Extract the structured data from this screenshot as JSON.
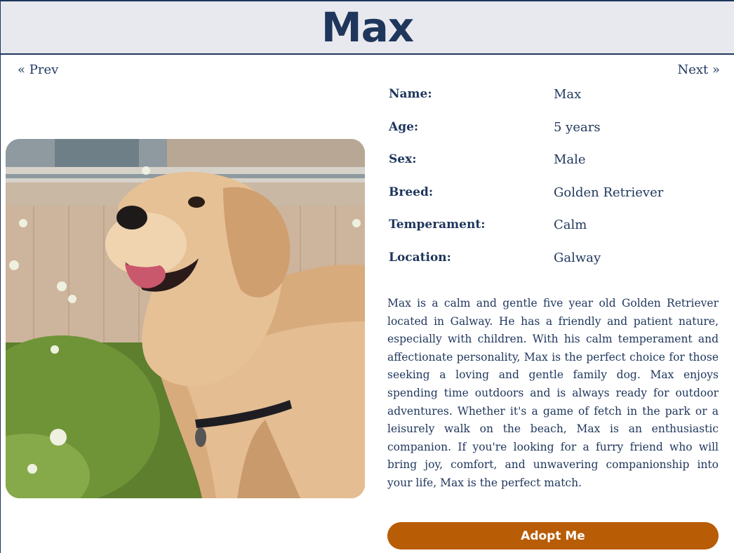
{
  "header": {
    "title": "Max"
  },
  "nav": {
    "prev_label": "« Prev",
    "next_label": "Next »"
  },
  "photo": {
    "alt": "Golden Retriever dog in a garden"
  },
  "details": [
    {
      "label": "Name:",
      "value": "Max"
    },
    {
      "label": "Age:",
      "value": "5 years"
    },
    {
      "label": "Sex:",
      "value": "Male"
    },
    {
      "label": "Breed:",
      "value": "Golden Retriever"
    },
    {
      "label": "Temperament:",
      "value": "Calm"
    },
    {
      "label": "Location:",
      "value": "Galway"
    }
  ],
  "description": "Max is a calm and gentle five year old Golden Retriever located in Galway. He has a friendly and patient nature, especially with children. With his calm temperament and affectionate personality, Max is the perfect choice for those seeking a loving and gentle family dog. Max enjoys spending time outdoors and is always ready for outdoor adventures. Whether it's a game of fetch in the park or a leisurely walk on the beach, Max is an enthusiastic companion. If you're looking for a furry friend who will bring joy, comfort, and unwavering companionship into your life, Max is the perfect match.",
  "adopt_button": {
    "label": "Adopt Me"
  },
  "colors": {
    "primary": "#1f365c",
    "header_bg": "#e8e9ef",
    "button_bg": "#b85c06",
    "button_text": "#ffffff"
  }
}
